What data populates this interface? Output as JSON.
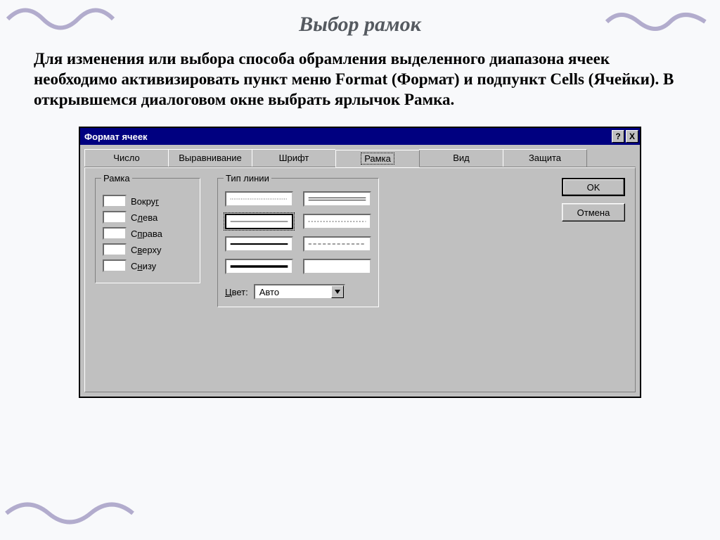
{
  "slide": {
    "title": "Выбор рамок",
    "body": "Для изменения или выбора способа обрамления выделенного диапазона ячеек необходимо активизировать пункт меню Format (Формат) и подпункт Cells (Ячейки). В открывшемся диалоговом окне выбрать ярлычок Рамка."
  },
  "dialog": {
    "title": "Формат ячеек",
    "help_symbol": "?",
    "close_symbol": "X",
    "tabs": {
      "number": "Число",
      "alignment": "Выравнивание",
      "font": "Шрифт",
      "border": "Рамка",
      "view": "Вид",
      "protection": "Защита"
    },
    "ramka": {
      "legend": "Рамка",
      "around_pre": "Вокру",
      "around_u": "г",
      "left_pre": "С",
      "left_u": "л",
      "left_post": "ева",
      "right_pre": "С",
      "right_u": "п",
      "right_post": "рава",
      "top_pre": "С",
      "top_u": "в",
      "top_post": "ерху",
      "bottom_pre": "С",
      "bottom_u": "н",
      "bottom_post": "изу"
    },
    "linetype": {
      "legend": "Тип линии",
      "color_pre": "",
      "color_u": "Ц",
      "color_post": "вет:",
      "color_value": "Авто"
    },
    "buttons": {
      "ok": "OK",
      "cancel": "Отмена"
    }
  }
}
